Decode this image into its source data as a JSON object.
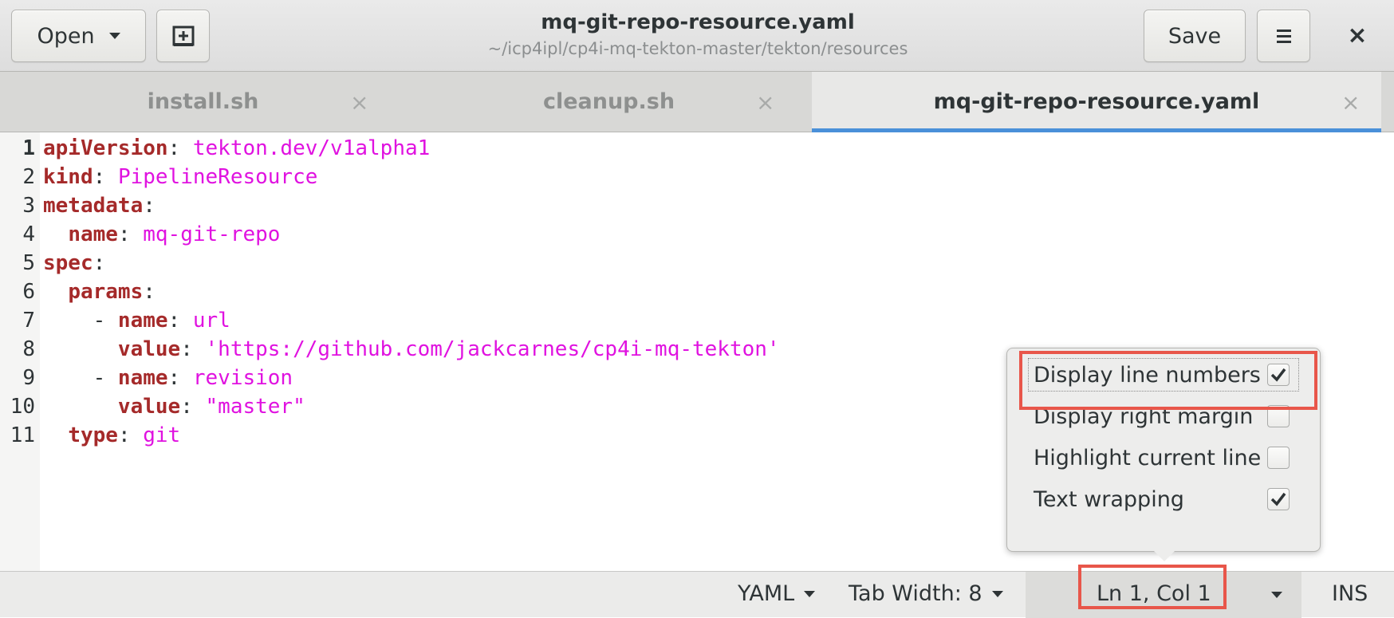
{
  "header": {
    "open_label": "Open",
    "title": "mq-git-repo-resource.yaml",
    "subtitle": "~/icp4ipl/cp4i-mq-tekton-master/tekton/resources",
    "save_label": "Save",
    "close_glyph": "×"
  },
  "tabs": [
    {
      "label": "install.sh",
      "close": "×",
      "active": false
    },
    {
      "label": "cleanup.sh",
      "close": "×",
      "active": false
    },
    {
      "label": "mq-git-repo-resource.yaml",
      "close": "×",
      "active": true
    }
  ],
  "editor": {
    "lines": [
      {
        "n": "1",
        "indent": "",
        "key": "apiVersion",
        "sep": ": ",
        "value": "tekton.dev/v1alpha1"
      },
      {
        "n": "2",
        "indent": "",
        "key": "kind",
        "sep": ": ",
        "value": "PipelineResource"
      },
      {
        "n": "3",
        "indent": "",
        "key": "metadata",
        "sep": ":",
        "value": ""
      },
      {
        "n": "4",
        "indent": "  ",
        "key": "name",
        "sep": ": ",
        "value": "mq-git-repo"
      },
      {
        "n": "5",
        "indent": "",
        "key": "spec",
        "sep": ":",
        "value": ""
      },
      {
        "n": "6",
        "indent": "  ",
        "key": "params",
        "sep": ":",
        "value": ""
      },
      {
        "n": "7",
        "indent": "    - ",
        "key": "name",
        "sep": ": ",
        "value": "url"
      },
      {
        "n": "8",
        "indent": "      ",
        "key": "value",
        "sep": ": ",
        "value": "'https://github.com/jackcarnes/cp4i-mq-tekton'"
      },
      {
        "n": "9",
        "indent": "    - ",
        "key": "name",
        "sep": ": ",
        "value": "revision"
      },
      {
        "n": "10",
        "indent": "      ",
        "key": "value",
        "sep": ": ",
        "value": "\"master\""
      },
      {
        "n": "11",
        "indent": "  ",
        "key": "type",
        "sep": ": ",
        "value": "git"
      }
    ]
  },
  "status": {
    "language": "YAML",
    "tab_width": "Tab Width: 8",
    "position": "Ln 1, Col 1",
    "mode": "INS"
  },
  "view_popover": {
    "options": [
      {
        "label": "Display line numbers",
        "checked": true
      },
      {
        "label": "Display right margin",
        "checked": false
      },
      {
        "label": "Highlight current line",
        "checked": false
      },
      {
        "label": "Text wrapping",
        "checked": true
      }
    ]
  },
  "colors": {
    "yaml_key": "#a52a2a",
    "yaml_value": "#e012e0",
    "tab_accent": "#4a90d9",
    "highlight_box": "#e8564a"
  }
}
